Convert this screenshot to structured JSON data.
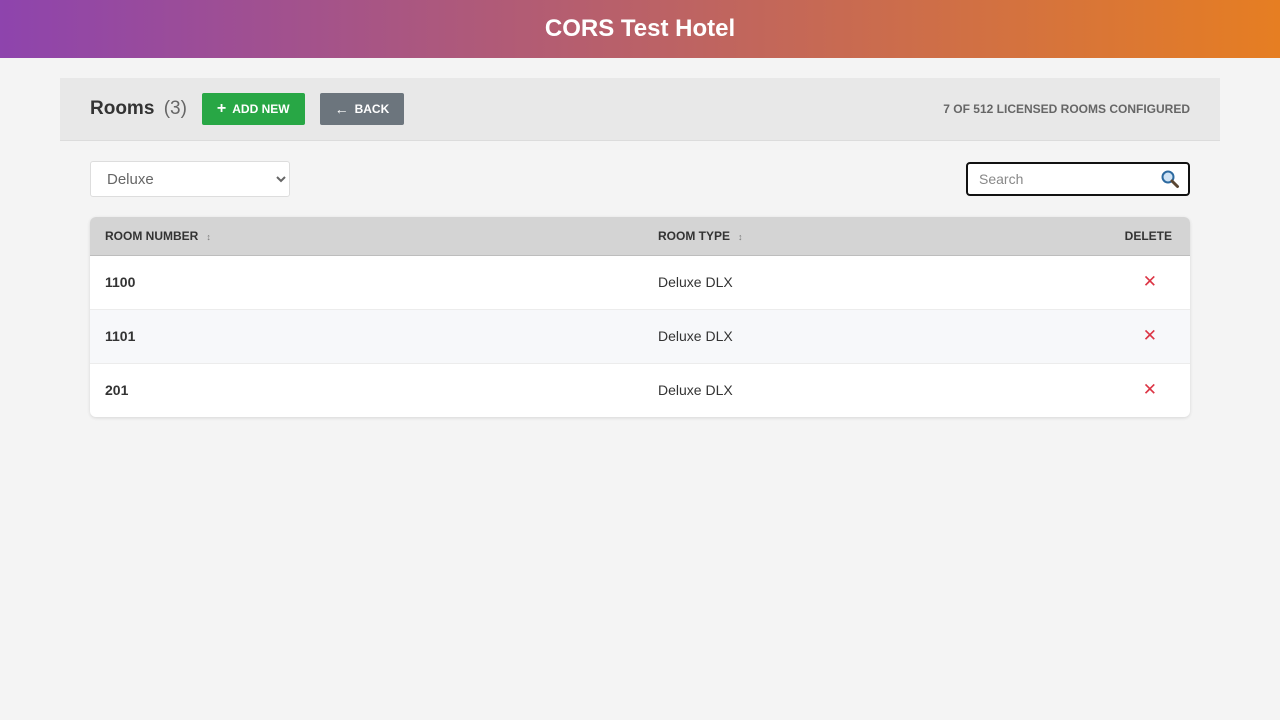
{
  "header": {
    "title": "CORS Test Hotel"
  },
  "toolbar": {
    "title": "Rooms",
    "count": "(3)",
    "add_label": "ADD NEW",
    "back_label": "BACK",
    "license_text": "7 OF 512 LICENSED ROOMS CONFIGURED"
  },
  "filters": {
    "room_type_selected": "Deluxe",
    "search_placeholder": "Search"
  },
  "table": {
    "columns": {
      "room_number": "ROOM NUMBER",
      "room_type": "ROOM TYPE",
      "delete": "DELETE"
    },
    "rows": [
      {
        "room_number": "1100",
        "room_type": "Deluxe DLX"
      },
      {
        "room_number": "1101",
        "room_type": "Deluxe DLX"
      },
      {
        "room_number": "201",
        "room_type": "Deluxe DLX"
      }
    ]
  },
  "icons": {
    "sort": "sort-icon",
    "delete": "close-icon",
    "search": "search-icon",
    "add": "plus-icon",
    "back": "arrow-left-icon"
  },
  "colors": {
    "header_gradient_start": "#8e44ad",
    "header_gradient_end": "#e67e22",
    "add_button": "#28a745",
    "back_button": "#6c757d",
    "delete_icon": "#dc3545"
  }
}
